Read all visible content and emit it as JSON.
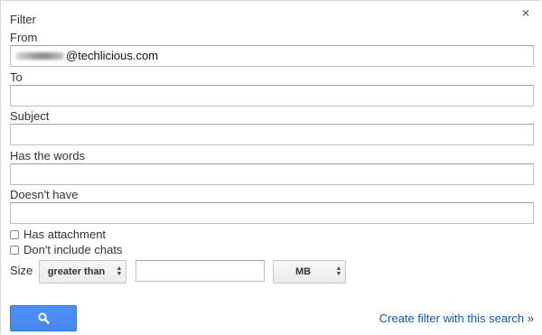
{
  "dialog": {
    "title": "Filter",
    "close_glyph": "×"
  },
  "fields": {
    "from_label": "From",
    "from_value": "@techlicious.com",
    "to_label": "To",
    "to_value": "",
    "subject_label": "Subject",
    "subject_value": "",
    "has_words_label": "Has the words",
    "has_words_value": "",
    "doesnt_have_label": "Doesn't have",
    "doesnt_have_value": ""
  },
  "options": {
    "has_attachment_label": "Has attachment",
    "has_attachment_checked": false,
    "no_chats_label": "Don't include chats",
    "no_chats_checked": false
  },
  "size": {
    "label": "Size",
    "operator_selected": "greater than",
    "value": "",
    "unit_selected": "MB"
  },
  "actions": {
    "search_icon": "search-icon",
    "create_filter_link": "Create filter with this search »"
  },
  "colors": {
    "accent_blue": "#4d90fe",
    "link_blue": "#1155cc"
  }
}
